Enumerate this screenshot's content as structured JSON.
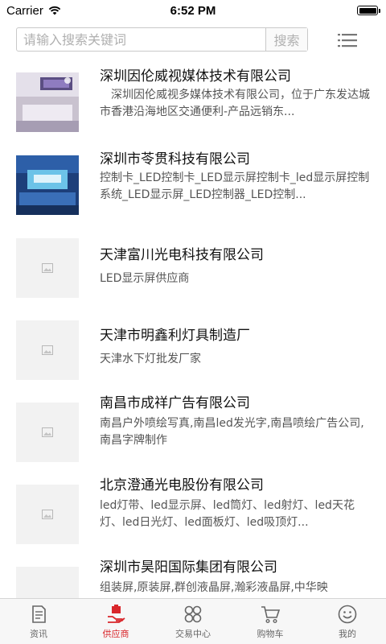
{
  "status_bar": {
    "carrier": "Carrier",
    "time": "6:52 PM"
  },
  "search": {
    "placeholder": "请输入搜索关键词",
    "button_label": "搜索"
  },
  "companies": [
    {
      "name": "深圳因伦威视媒体技术有限公司",
      "description": "深圳因伦威视多媒体技术有限公司，位于广东发达城市香港沿海地区交通便利-产品远销东...",
      "thumbnail": "photo-office"
    },
    {
      "name": "深圳市苓贯科技有限公司",
      "description": "控制卡_LED控制卡_LED显示屏控制卡_led显示屏控制系统_LED显示屏_LED控制器_LED控制...",
      "thumbnail": "photo-reception"
    },
    {
      "name": "天津富川光电科技有限公司",
      "description": "LED显示屏供应商",
      "thumbnail": "image-placeholder-icon"
    },
    {
      "name": "天津市明鑫利灯具制造厂",
      "description": "天津水下灯批发厂家",
      "thumbnail": "image-placeholder-icon"
    },
    {
      "name": "南昌市成祥广告有限公司",
      "description": "南昌户外喷绘写真,南昌led发光字,南昌喷绘广告公司,南昌字牌制作",
      "thumbnail": "image-placeholder-icon"
    },
    {
      "name": "北京澄通光电股份有限公司",
      "description": "led灯带、led显示屏、led筒灯、led射灯、led天花灯、led日光灯、led面板灯、led吸顶灯...",
      "thumbnail": "image-placeholder-icon"
    },
    {
      "name": "深圳市昊阳国际集团有限公司",
      "description": "组装屏,原装屏,群创液晶屏,瀚彩液晶屏,中华映",
      "thumbnail": "image-placeholder-icon"
    }
  ],
  "tabs": [
    {
      "label": "资讯",
      "icon": "document-icon",
      "active": false
    },
    {
      "label": "供应商",
      "icon": "hand-icon",
      "active": true
    },
    {
      "label": "交易中心",
      "icon": "grid-icon",
      "active": false
    },
    {
      "label": "购物车",
      "icon": "cart-icon",
      "active": false
    },
    {
      "label": "我的",
      "icon": "smiley-icon",
      "active": false
    }
  ],
  "colors": {
    "accent": "#d9262b",
    "tab_text": "#666666"
  }
}
